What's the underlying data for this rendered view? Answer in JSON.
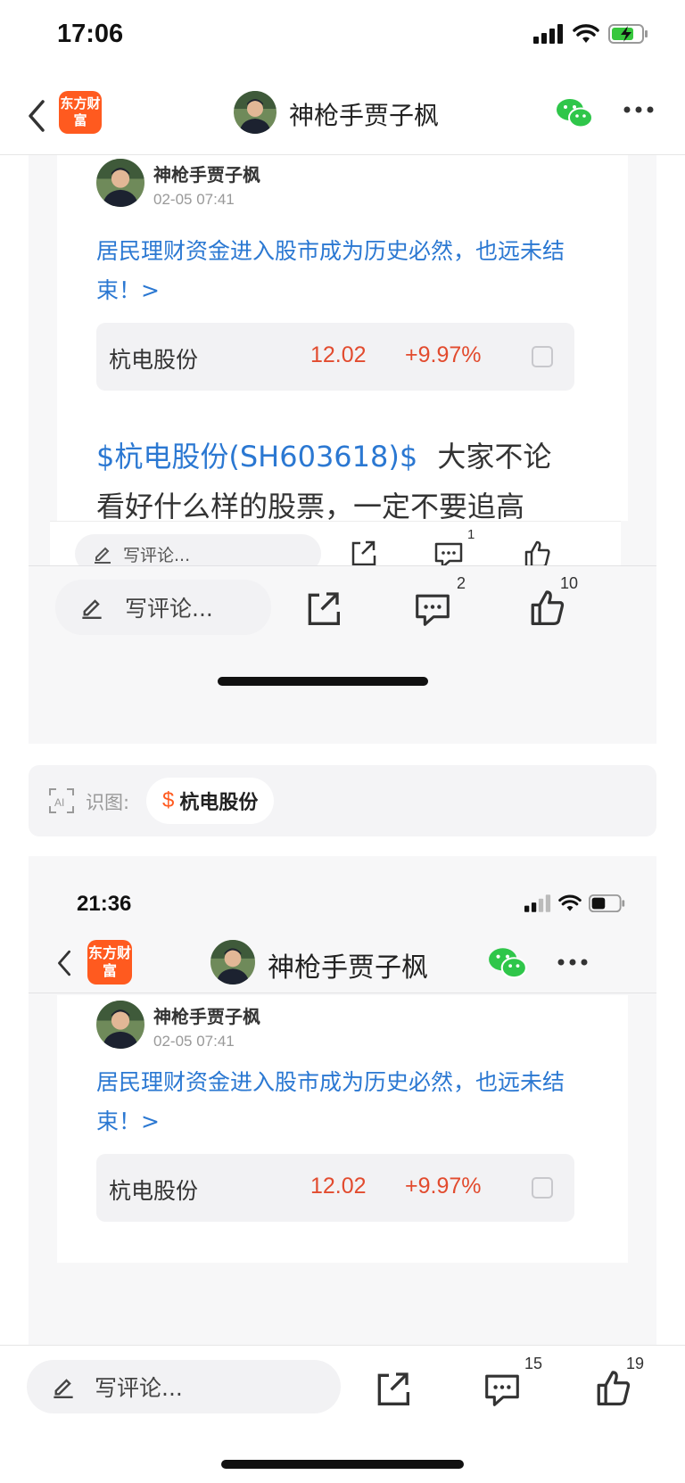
{
  "status_bar": {
    "time": "17:06"
  },
  "nav": {
    "logo_text": "东方财富",
    "title": "神枪手贾子枫"
  },
  "shot1": {
    "post": {
      "author": "神枪手贾子枫",
      "time": "02-05 07:41",
      "title": "居民理财资金进入股市成为历史必然，也远未结束！>"
    },
    "stock": {
      "name": "杭电股份",
      "price": "12.02",
      "change": "+9.97%"
    },
    "body_link": "$杭电股份(SH603618)$",
    "body_line1": "大家不论",
    "body_line2": "看好什么样的股票，一定不要追高",
    "inner_bar": {
      "comment_placeholder": "写评论...",
      "comment_count": "1"
    },
    "outer_bar": {
      "comment_placeholder": "写评论...",
      "comment_count": "2",
      "like_count": "10"
    }
  },
  "ai_bar": {
    "label": "识图:",
    "chip_symbol": "$",
    "chip_name": "杭电股份"
  },
  "shot2": {
    "status_time": "21:36",
    "nav": {
      "logo_text": "东方财富",
      "title": "神枪手贾子枫"
    },
    "post": {
      "author": "神枪手贾子枫",
      "time": "02-05 07:41",
      "title": "居民理财资金进入股市成为历史必然，也远未结束！>"
    },
    "stock": {
      "name": "杭电股份",
      "price": "12.02",
      "change": "+9.97%"
    }
  },
  "bottom_bar": {
    "comment_placeholder": "写评论...",
    "comment_count": "15",
    "like_count": "19"
  },
  "colors": {
    "accent_orange": "#ff5a1f",
    "link_blue": "#2b78d2",
    "price_red": "#e24b2e",
    "wechat_green": "#2fc64a"
  }
}
